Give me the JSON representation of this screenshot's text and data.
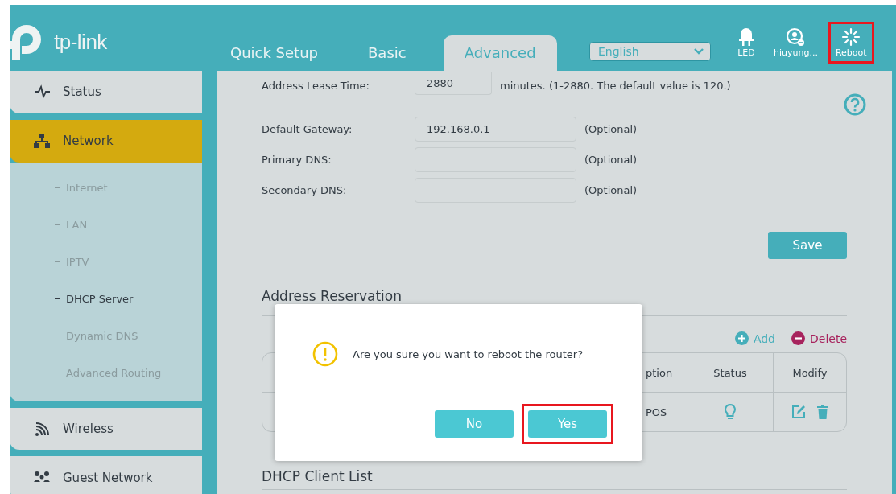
{
  "header": {
    "logo": "tp-link",
    "tabs": [
      {
        "label": "Quick Setup",
        "selected": false
      },
      {
        "label": "Basic",
        "selected": false
      },
      {
        "label": "Advanced",
        "selected": true
      }
    ],
    "language": "English",
    "tools": [
      {
        "label": "LED",
        "kind": "led",
        "highlighted": false
      },
      {
        "label": "hiuyung...",
        "kind": "user",
        "highlighted": false
      },
      {
        "label": "Reboot",
        "kind": "reboot",
        "highlighted": true
      }
    ]
  },
  "sidebar": {
    "items": [
      {
        "label": "Status",
        "kind": "status",
        "selected": false
      },
      {
        "label": "Network",
        "kind": "network",
        "selected": true,
        "children": [
          {
            "label": "Internet",
            "selected": false
          },
          {
            "label": "LAN",
            "selected": false
          },
          {
            "label": "IPTV",
            "selected": false
          },
          {
            "label": "DHCP Server",
            "selected": true
          },
          {
            "label": "Dynamic DNS",
            "selected": false
          },
          {
            "label": "Advanced Routing",
            "selected": false
          }
        ]
      },
      {
        "label": "Wireless",
        "kind": "wireless",
        "selected": false
      },
      {
        "label": "Guest Network",
        "kind": "guest",
        "selected": false
      }
    ]
  },
  "form": {
    "rows": [
      {
        "label": "Address Lease Time:",
        "kind": "short",
        "value": "2880",
        "hint": "minutes. (1-2880. The default value is 120.)"
      },
      {
        "label": "Default Gateway:",
        "kind": "long",
        "value": "192.168.0.1",
        "hint": "(Optional)"
      },
      {
        "label": "Primary DNS:",
        "kind": "long",
        "hint": "(Optional)"
      },
      {
        "label": "Secondary DNS:",
        "kind": "long",
        "hint": "(Optional)"
      }
    ],
    "save_button": "Save"
  },
  "reservation": {
    "title": "Address Reservation",
    "add": "Add",
    "delete": "Delete",
    "table": {
      "columns": [
        "ption",
        "Status",
        "Modify"
      ],
      "rows": [
        {
          "cells": [
            "POS"
          ]
        }
      ]
    }
  },
  "client_list": {
    "title": "DHCP Client List"
  },
  "dialog": {
    "message": "Are you sure you want to reboot the router?",
    "buttons": [
      {
        "label": "No",
        "highlighted": false
      },
      {
        "label": "Yes",
        "highlighted": true
      }
    ]
  }
}
